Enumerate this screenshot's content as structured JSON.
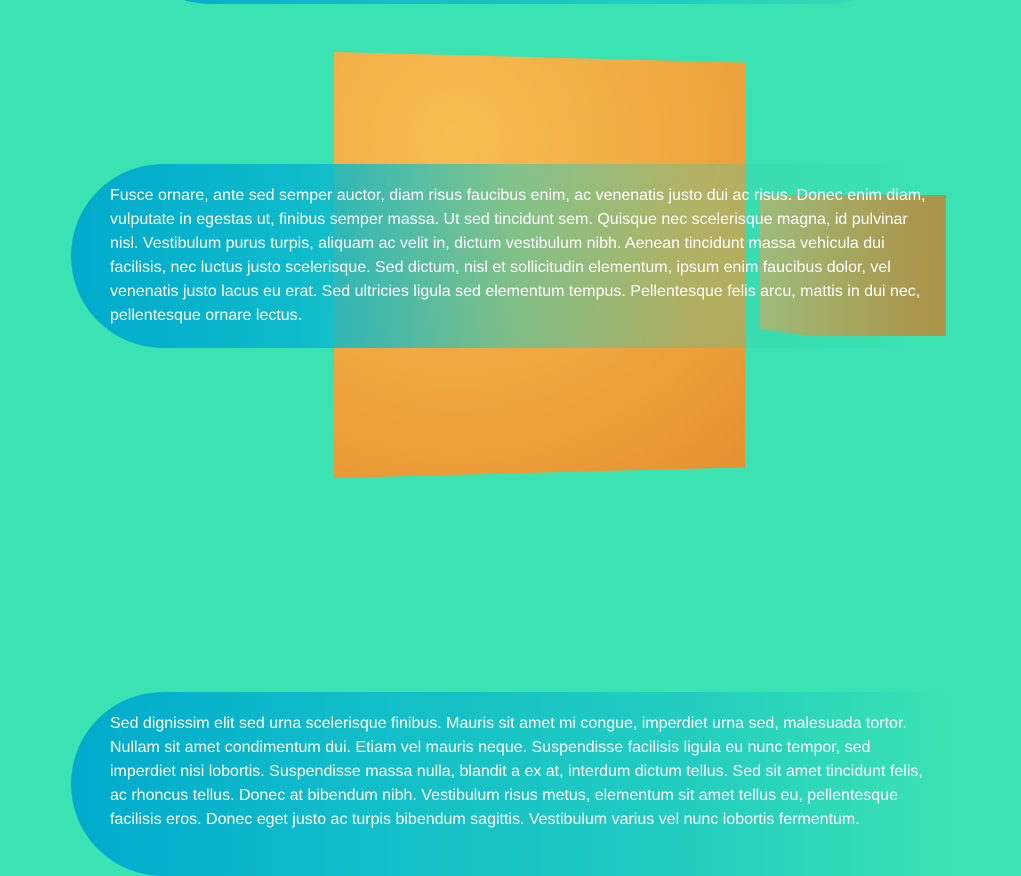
{
  "blocks": [
    {
      "text": "Fusce ornare, ante sed semper auctor, diam risus faucibus enim, ac venenatis justo dui ac risus. Donec enim diam, vulputate in egestas ut, finibus semper massa. Ut sed tincidunt sem. Quisque nec scelerisque magna, id pulvinar nisl. Vestibulum purus turpis, aliquam ac velit in, dictum vestibulum nibh. Aenean tincidunt massa vehicula dui facilisis, nec luctus justo scelerisque. Sed dictum, nisl et sollicitudin elementum, ipsum enim faucibus dolor, vel venenatis justo lacus eu erat. Sed ultricies ligula sed elementum tempus. Pellentesque felis arcu, mattis in dui nec, pellentesque ornare lectus."
    },
    {
      "text": "Sed dignissim elit sed urna scelerisque finibus. Mauris sit amet mi congue, imperdiet urna sed, malesuada tortor. Nullam sit amet condimentum dui. Etiam vel mauris neque. Suspendisse facilisis ligula eu nunc tempor, sed imperdiet nisi lobortis. Suspendisse massa nulla, blandit a ex at, interdum dictum tellus. Sed sit amet tincidunt felis, ac rhoncus tellus. Donec at bibendum nibh. Vestibulum risus metus, elementum sit amet tellus eu, pellentesque facilisis eros. Donec eget justo ac turpis bibendum sagittis. Vestibulum varius vel nunc lobortis fermentum."
    }
  ],
  "colors": {
    "background": "#3be3b2",
    "pill_start": "#00aacd",
    "shape_orange": "#f1ad45",
    "shape_side": "#c8822f"
  }
}
